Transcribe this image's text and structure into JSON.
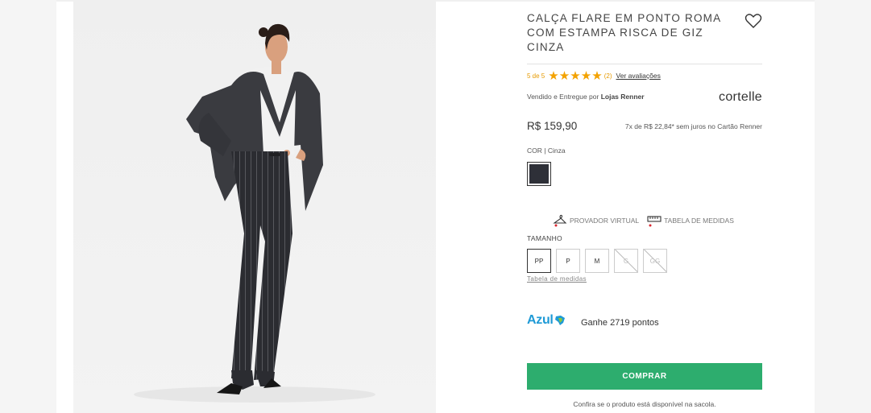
{
  "product": {
    "title": "CALÇA FLARE EM PONTO ROMA COM ESTAMPA RISCA DE GIZ CINZA",
    "brand": "cortelle",
    "price": "R$ 159,90",
    "installments": "7x de R$ 22,84* sem juros no Cartão Renner"
  },
  "rating": {
    "text": "5 de 5",
    "stars": [
      "★",
      "★",
      "★",
      "★",
      "★"
    ],
    "value": 5,
    "max": 5,
    "count": "(2)",
    "link": "Ver avaliações"
  },
  "seller": {
    "prefix": "Vendido e Entregue por",
    "name": "Lojas Renner"
  },
  "color": {
    "label": "COR",
    "value": "Cinza",
    "swatch": "#2e3038"
  },
  "tools": {
    "virtual_fitting": "PROVADOR VIRTUAL",
    "size_chart": "TABELA DE MEDIDAS"
  },
  "sizes": {
    "label": "TAMANHO",
    "options": [
      {
        "label": "PP",
        "selected": true,
        "available": true
      },
      {
        "label": "P",
        "selected": false,
        "available": true
      },
      {
        "label": "M",
        "selected": false,
        "available": true
      },
      {
        "label": "G",
        "selected": false,
        "available": false
      },
      {
        "label": "GG",
        "selected": false,
        "available": false
      }
    ],
    "table_link": "Tabela de medidas"
  },
  "loyalty": {
    "logo_text": "Azul",
    "points": "Ganhe 2719 pontos"
  },
  "actions": {
    "buy_label": "COMPRAR",
    "confirm_note": "Confira se o produto está disponível na sacola."
  },
  "colors": {
    "accent_green": "#2dad6e",
    "star": "#f3a200",
    "azul_blue": "#1e9ad6"
  }
}
